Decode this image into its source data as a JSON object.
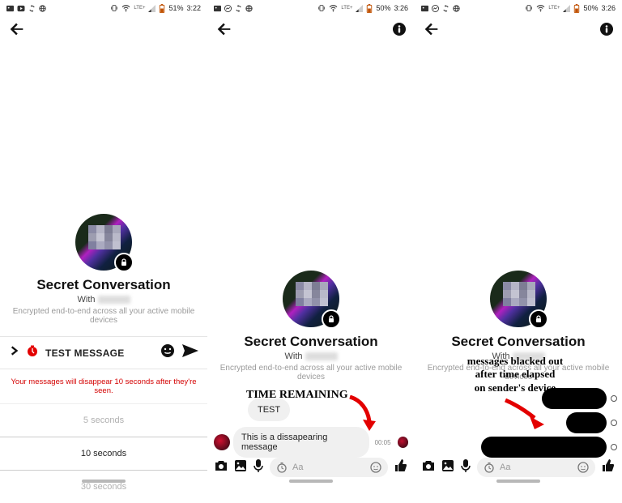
{
  "status": {
    "time1": "3:22",
    "battery1": "51%",
    "time2": "3:26",
    "battery2": "50%",
    "lte": "LTE+"
  },
  "common": {
    "title": "Secret Conversation",
    "with": "With",
    "encrypted": "Encrypted end-to-end across all your active mobile devices"
  },
  "panel1": {
    "compose_text": "TEST MESSAGE",
    "warn": "Your messages will disappear 10 seconds after they're seen.",
    "options": [
      "5 seconds",
      "10 seconds",
      "30 seconds"
    ],
    "selected_index": 1
  },
  "panel2": {
    "annotation": "TIME REMAINING",
    "msg1": "TEST",
    "msg2": "This is a dissapearing message",
    "timer": "00:05",
    "placeholder": "Aa"
  },
  "panel3": {
    "annotation": "messages blacked out\nafter time elapsed\non sender's device",
    "placeholder": "Aa"
  }
}
